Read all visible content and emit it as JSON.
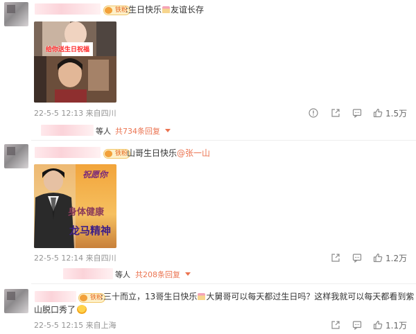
{
  "comments": [
    {
      "badge": "铁粉",
      "text": ":生日快乐",
      "text_after": "友谊长存",
      "meta": "22-5-5 12:13 来自四川",
      "likes": "1.5万",
      "image_icon": "video-still-image",
      "image_caption": "给你送生日祝福"
    },
    {
      "badge": "铁粉",
      "text": "山哥生日快乐",
      "mention": "@张一山",
      "meta": "22-5-5 12:14 来自四川",
      "likes": "1.2万",
      "image_icon": "greeting-card-image",
      "image_lines": [
        "祝愿你",
        "身体健康",
        "龙马精神"
      ],
      "replies": {
        "suffix": "等人",
        "count": "共734条回复"
      }
    },
    {
      "badge": "铁粉",
      "text": ":三十而立，13哥生日快乐",
      "text_after": "大舅哥可以每天都过生日吗？这样我就可以每天都看到紫",
      "text_line2": "山脱口秀了",
      "meta": "22-5-5 12:15 来自上海",
      "likes": "1.1万",
      "replies": {
        "suffix": "等人",
        "count": "共208条回复"
      }
    }
  ],
  "first_replies": {
    "suffix": "等人",
    "count": "共734条回复"
  },
  "second_replies": {
    "suffix": "等人",
    "count": "共208条回复"
  },
  "colors": {
    "accent": "#eb7350",
    "meta": "#939393",
    "reply_bg": "#f7f7f7"
  }
}
